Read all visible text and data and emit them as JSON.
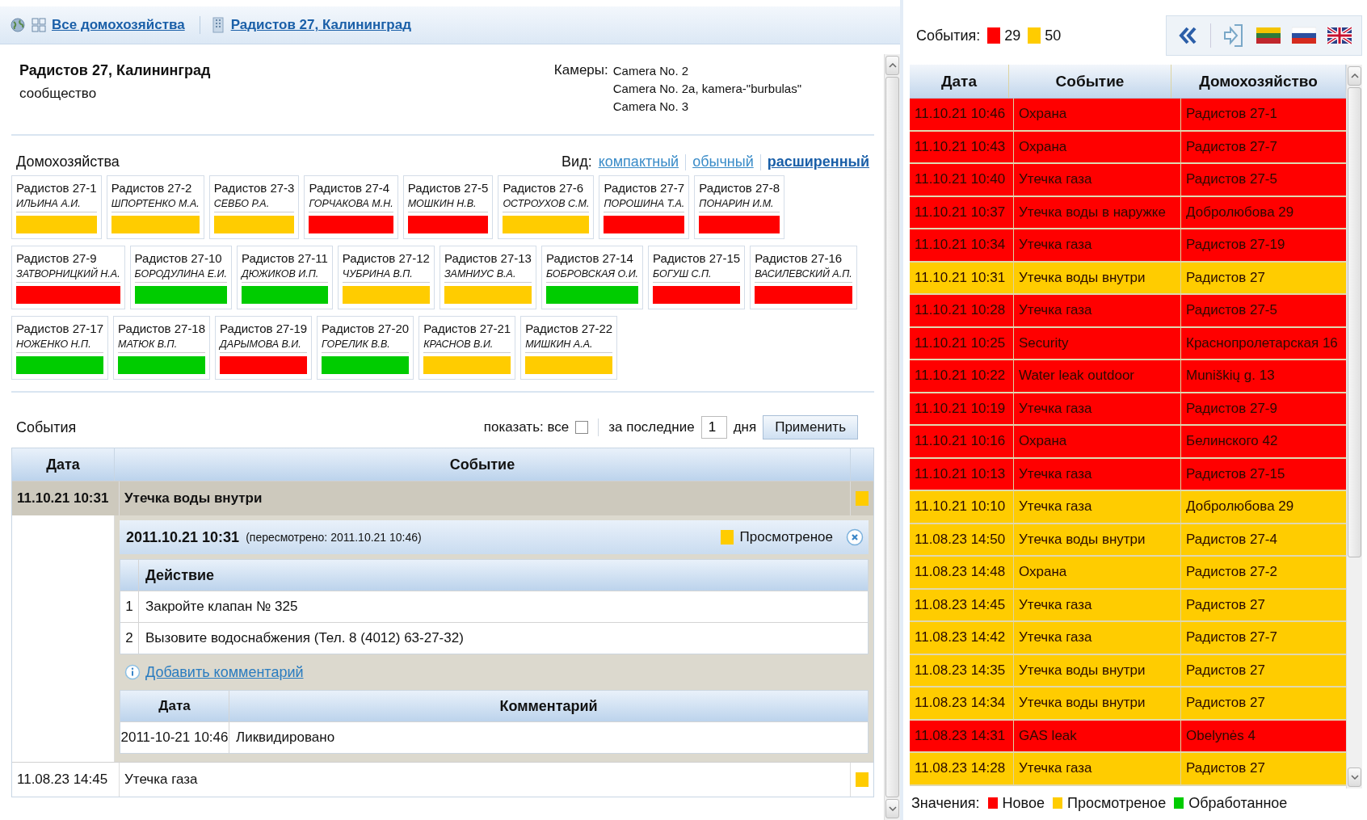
{
  "breadcrumb": [
    {
      "label": "Все домохозяйства",
      "kind": "group"
    },
    {
      "label": "Радистов 27, Калининград",
      "kind": "building"
    }
  ],
  "community": {
    "title": "Радистов 27, Калининград",
    "subtitle": "сообщество",
    "cameras_label": "Камеры:",
    "cameras": [
      "Camera No. 2",
      "Camera No. 2a, kamera-\"burbulas\"",
      "Camera No. 3"
    ]
  },
  "households": {
    "title": "Домохозяйства",
    "view_label": "Вид:",
    "views": [
      {
        "label": "компактный",
        "selected": false
      },
      {
        "label": "обычный",
        "selected": false
      },
      {
        "label": "расширенный",
        "selected": true
      }
    ],
    "items": [
      {
        "name": "Радистов 27-1",
        "owner": "ИЛЬИНА А.И.",
        "color": "#ffcc00"
      },
      {
        "name": "Радистов 27-2",
        "owner": "ШПОРТЕНКО М.А.",
        "color": "#ffcc00"
      },
      {
        "name": "Радистов 27-3",
        "owner": "СЕВБО Р.А.",
        "color": "#ffcc00"
      },
      {
        "name": "Радистов 27-4",
        "owner": "ГОРЧАКОВА М.Н.",
        "color": "#ff0000"
      },
      {
        "name": "Радистов 27-5",
        "owner": "МОШКИН Н.В.",
        "color": "#ff0000"
      },
      {
        "name": "Радистов 27-6",
        "owner": "ОСТРОУХОВ С.М.",
        "color": "#ffcc00"
      },
      {
        "name": "Радистов 27-7",
        "owner": "ПОРОШИНА Т.А.",
        "color": "#ff0000"
      },
      {
        "name": "Радистов 27-8",
        "owner": "ПОНАРИН И.М.",
        "color": "#ff0000"
      },
      {
        "name": "Радистов 27-9",
        "owner": "ЗАТВОРНИЦКИЙ Н.А.",
        "color": "#ff0000"
      },
      {
        "name": "Радистов 27-10",
        "owner": "БОРОДУЛИНА Е.И.",
        "color": "#00cc00"
      },
      {
        "name": "Радистов 27-11",
        "owner": "ДЮЖИКОВ И.П.",
        "color": "#00cc00"
      },
      {
        "name": "Радистов 27-12",
        "owner": "ЧУБРИНА В.П.",
        "color": "#ffcc00"
      },
      {
        "name": "Радистов 27-13",
        "owner": "ЗАМНИУС В.А.",
        "color": "#ffcc00"
      },
      {
        "name": "Радистов 27-14",
        "owner": "БОБРОВСКАЯ О.И.",
        "color": "#00cc00"
      },
      {
        "name": "Радистов 27-15",
        "owner": "БОГУШ С.П.",
        "color": "#ff0000"
      },
      {
        "name": "Радистов 27-16",
        "owner": "ВАСИЛЕВСКИЙ А.П.",
        "color": "#ff0000"
      },
      {
        "name": "Радистов 27-17",
        "owner": "НОЖЕНКО Н.П.",
        "color": "#00cc00"
      },
      {
        "name": "Радистов 27-18",
        "owner": "МАТЮК В.П.",
        "color": "#00cc00"
      },
      {
        "name": "Радистов 27-19",
        "owner": "ДАРЫМОВА В.И.",
        "color": "#ff0000"
      },
      {
        "name": "Радистов 27-20",
        "owner": "ГОРЕЛИК В.В.",
        "color": "#00cc00"
      },
      {
        "name": "Радистов 27-21",
        "owner": "КРАСНОВ В.И.",
        "color": "#ffcc00"
      },
      {
        "name": "Радистов 27-22",
        "owner": "МИШКИН А.А.",
        "color": "#ffcc00"
      }
    ]
  },
  "events": {
    "title": "События",
    "show_label": "показать: все",
    "show_all": false,
    "period_label": "за последние",
    "period_value": "1",
    "period_unit": "дня",
    "apply": "Применить",
    "columns": [
      "Дата",
      "Событие"
    ],
    "rows": [
      {
        "date": "11.10.21 10:31",
        "event": "Утечка воды внутри",
        "color": "#ffcc00",
        "expanded": true,
        "detail": {
          "timestamp": "2011.10.21 10:31",
          "reviewed": "(пересмотрено: 2011.10.21 10:46)",
          "status": {
            "label": "Просмотреное",
            "color": "#ffcc00"
          },
          "actions_header": "Действие",
          "actions": [
            {
              "n": "1",
              "text": "Закройте клапан № 325"
            },
            {
              "n": "2",
              "text": "Вызовите водоснабжения (Тел. 8 (4012) 63-27-32)"
            }
          ],
          "add_comment": "Добавить комментарий",
          "comment_columns": [
            "Дата",
            "Комментарий"
          ],
          "comments": [
            {
              "date": "2011-10-21 10:46",
              "text": "Ликвидировано"
            }
          ]
        }
      },
      {
        "date": "11.08.23 14:45",
        "event": "Утечка газа",
        "color": "#ffcc00",
        "expanded": false
      }
    ]
  },
  "side": {
    "counts_label": "События:",
    "counts": [
      {
        "value": "29",
        "color": "#ff0000"
      },
      {
        "value": "50",
        "color": "#ffcc00"
      }
    ],
    "columns": [
      "Дата",
      "Событие",
      "Домохозяйство"
    ],
    "rows": [
      {
        "date": "11.10.21 10:46",
        "event": "Охрана",
        "household": "Радистов 27-1",
        "color": "#ff0000"
      },
      {
        "date": "11.10.21 10:43",
        "event": "Охрана",
        "household": "Радистов 27-7",
        "color": "#ff0000"
      },
      {
        "date": "11.10.21 10:40",
        "event": "Утечка газа",
        "household": "Радистов 27-5",
        "color": "#ff0000"
      },
      {
        "date": "11.10.21 10:37",
        "event": "Утечка воды в наружке",
        "household": "Добролюбова 29",
        "color": "#ff0000"
      },
      {
        "date": "11.10.21 10:34",
        "event": "Утечка газа",
        "household": "Радистов 27-19",
        "color": "#ff0000"
      },
      {
        "date": "11.10.21 10:31",
        "event": "Утечка воды внутри",
        "household": "Радистов 27",
        "color": "#ffcc00"
      },
      {
        "date": "11.10.21 10:28",
        "event": "Утечка газа",
        "household": "Радистов 27-5",
        "color": "#ff0000"
      },
      {
        "date": "11.10.21 10:25",
        "event": "Security",
        "household": "Краснопролетарская 16",
        "color": "#ff0000"
      },
      {
        "date": "11.10.21 10:22",
        "event": "Water leak outdoor",
        "household": "Muniškių g. 13",
        "color": "#ff0000"
      },
      {
        "date": "11.10.21 10:19",
        "event": "Утечка газа",
        "household": "Радистов 27-9",
        "color": "#ff0000"
      },
      {
        "date": "11.10.21 10:16",
        "event": "Охрана",
        "household": "Белинского 42",
        "color": "#ff0000"
      },
      {
        "date": "11.10.21 10:13",
        "event": "Утечка газа",
        "household": "Радистов 27-15",
        "color": "#ff0000"
      },
      {
        "date": "11.10.21 10:10",
        "event": "Утечка газа",
        "household": "Добролюбова 29",
        "color": "#ffcc00"
      },
      {
        "date": "11.08.23 14:50",
        "event": "Утечка воды внутри",
        "household": "Радистов 27-4",
        "color": "#ffcc00"
      },
      {
        "date": "11.08.23 14:48",
        "event": "Охрана",
        "household": "Радистов 27-2",
        "color": "#ffcc00"
      },
      {
        "date": "11.08.23 14:45",
        "event": "Утечка газа",
        "household": "Радистов 27",
        "color": "#ffcc00"
      },
      {
        "date": "11.08.23 14:42",
        "event": "Утечка газа",
        "household": "Радистов 27-7",
        "color": "#ffcc00"
      },
      {
        "date": "11.08.23 14:35",
        "event": "Утечка воды внутри",
        "household": "Радистов 27",
        "color": "#ffcc00"
      },
      {
        "date": "11.08.23 14:34",
        "event": "Утечка воды внутри",
        "household": "Радистов 27",
        "color": "#ffcc00"
      },
      {
        "date": "11.08.23 14:31",
        "event": "GAS leak",
        "household": "Obelynės 4",
        "color": "#ff0000"
      },
      {
        "date": "11.08.23 14:28",
        "event": "Утечка газа",
        "household": "Радистов 27",
        "color": "#ffcc00"
      }
    ],
    "legend_label": "Значения:",
    "legend": [
      {
        "label": "Новое",
        "color": "#ff0000"
      },
      {
        "label": "Просмотреное",
        "color": "#ffcc00"
      },
      {
        "label": "Обработанное",
        "color": "#00cc00"
      }
    ]
  }
}
